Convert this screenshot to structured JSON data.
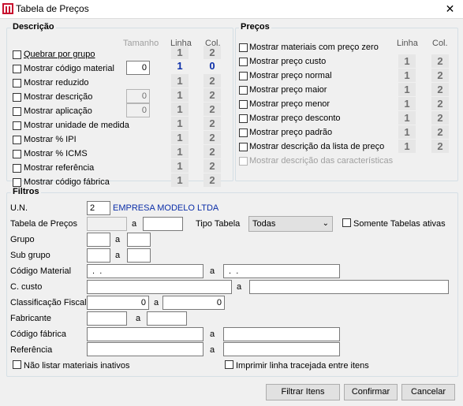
{
  "window": {
    "title": "Tabela de Preços",
    "close_label": "✕"
  },
  "descricao": {
    "legend": "Descrição",
    "headers": {
      "tamanho": "Tamanho",
      "linha": "Linha",
      "col": "Col."
    },
    "rows": [
      {
        "label": "Quebrar por grupo",
        "linha": "1",
        "col": "2"
      },
      {
        "label": "Mostrar código material",
        "tamanho": "0",
        "linha": "1",
        "col": "0"
      },
      {
        "label": "Mostrar reduzido",
        "linha": "1",
        "col": "2"
      },
      {
        "label": "Mostrar descrição",
        "tamanho": "0",
        "linha": "1",
        "col": "2"
      },
      {
        "label": "Mostrar aplicação",
        "tamanho": "0",
        "linha": "1",
        "col": "2"
      },
      {
        "label": "Mostrar unidade de medida",
        "linha": "1",
        "col": "2"
      },
      {
        "label": "Mostrar % IPI",
        "linha": "1",
        "col": "2"
      },
      {
        "label": "Mostrar % ICMS",
        "linha": "1",
        "col": "2"
      },
      {
        "label": "Mostrar referência",
        "linha": "1",
        "col": "2"
      },
      {
        "label": "Mostrar código fábrica",
        "linha": "1",
        "col": "2"
      }
    ]
  },
  "precos": {
    "legend": "Preços",
    "headers": {
      "linha": "Linha",
      "col": "Col."
    },
    "rows": [
      {
        "label": "Mostrar materiais com preço zero"
      },
      {
        "label": "Mostrar preço custo",
        "linha": "1",
        "col": "2"
      },
      {
        "label": "Mostrar preço normal",
        "linha": "1",
        "col": "2"
      },
      {
        "label": "Mostrar preço maior",
        "linha": "1",
        "col": "2"
      },
      {
        "label": "Mostrar preço menor",
        "linha": "1",
        "col": "2"
      },
      {
        "label": "Mostrar preço desconto",
        "linha": "1",
        "col": "2"
      },
      {
        "label": "Mostrar preço padrão",
        "linha": "1",
        "col": "2"
      },
      {
        "label": "Mostrar descrição da lista de preço",
        "linha": "1",
        "col": "2"
      },
      {
        "label": "Mostrar descrição das características"
      }
    ]
  },
  "filtros": {
    "legend": "Filtros",
    "un_label": "U.N.",
    "un_value": "2",
    "company_name": "EMPRESA MODELO LTDA",
    "tabela_label": "Tabela  de Preços",
    "a_label": "a",
    "tipo_tabela_label": "Tipo Tabela",
    "tipo_tabela_value": "Todas",
    "somente_ativas_label": "Somente Tabelas ativas",
    "grupo_label": "Grupo",
    "subgrupo_label": "Sub grupo",
    "codigo_material_label": "Código Material",
    "codigo_material_from": " .  .",
    "codigo_material_to": " .  .",
    "c_custo_label": "C. custo",
    "classificacao_label": "Classificação Fiscal",
    "classificacao_from": "0",
    "classificacao_to": "0",
    "fabricante_label": "Fabricante",
    "codigo_fabrica_label": "Código fábrica",
    "referencia_label": "Referência",
    "nao_listar_label": "Não listar materiais inativos",
    "imprimir_linha_label": "Imprimir linha tracejada entre itens"
  },
  "buttons": {
    "filtrar": "Filtrar Itens",
    "confirmar": "Confirmar",
    "cancelar": "Cancelar"
  }
}
